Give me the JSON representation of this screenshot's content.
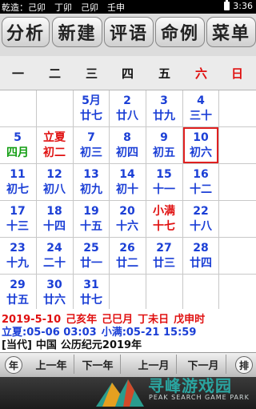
{
  "status_bar": {
    "left_text": "乾造：己卯　丁卯　己卯　壬申",
    "time": "3:36"
  },
  "tabs": [
    "分析",
    "新建",
    "评语",
    "命例",
    "菜单"
  ],
  "weekdays": [
    {
      "label": "一",
      "color": "normal"
    },
    {
      "label": "二",
      "color": "normal"
    },
    {
      "label": "三",
      "color": "normal"
    },
    {
      "label": "四",
      "color": "normal"
    },
    {
      "label": "五",
      "color": "normal"
    },
    {
      "label": "六",
      "color": "red"
    },
    {
      "label": "日",
      "color": "red"
    }
  ],
  "calendar": [
    [
      null,
      null,
      {
        "d": "5月",
        "l": "廿七"
      },
      {
        "d": "2",
        "l": "廿八"
      },
      {
        "d": "3",
        "l": "廿九"
      },
      {
        "d": "4",
        "l": "三十"
      },
      null
    ],
    [
      {
        "d": "5",
        "l": "四月",
        "l_color": "green"
      },
      {
        "d": "立夏",
        "d_color": "red",
        "l": "初二",
        "l_color": "red"
      },
      {
        "d": "7",
        "l": "初三"
      },
      {
        "d": "8",
        "l": "初四"
      },
      {
        "d": "9",
        "l": "初五"
      },
      {
        "d": "10",
        "l": "初六",
        "today": true
      },
      null
    ],
    [
      {
        "d": "11",
        "l": "初七"
      },
      {
        "d": "12",
        "l": "初八"
      },
      {
        "d": "13",
        "l": "初九"
      },
      {
        "d": "14",
        "l": "初十"
      },
      {
        "d": "15",
        "l": "十一"
      },
      {
        "d": "16",
        "l": "十二"
      },
      null
    ],
    [
      {
        "d": "17",
        "l": "十三"
      },
      {
        "d": "18",
        "l": "十四"
      },
      {
        "d": "19",
        "l": "十五"
      },
      {
        "d": "20",
        "l": "十六"
      },
      {
        "d": "小满",
        "d_color": "red",
        "l": "十七",
        "l_color": "red"
      },
      {
        "d": "22",
        "l": "十八"
      },
      null
    ],
    [
      {
        "d": "23",
        "l": "十九"
      },
      {
        "d": "24",
        "l": "二十"
      },
      {
        "d": "25",
        "l": "廿一"
      },
      {
        "d": "26",
        "l": "廿二"
      },
      {
        "d": "27",
        "l": "廿三"
      },
      {
        "d": "28",
        "l": "廿四"
      },
      null
    ],
    [
      {
        "d": "29",
        "l": "廿五"
      },
      {
        "d": "30",
        "l": "廿六"
      },
      {
        "d": "31",
        "l": "廿七"
      },
      null,
      null,
      null,
      null
    ]
  ],
  "info": {
    "line1": [
      "2019-5-10",
      "己亥年",
      "己巳月",
      "丁未日",
      "戊申时"
    ],
    "line2": [
      "立夏:05-06 03:03",
      "小满:05-21 15:59"
    ],
    "line3": [
      "[当代]",
      "中国",
      "公历纪元2019年"
    ]
  },
  "nav": {
    "year_btn": "年",
    "prev_year": "上一年",
    "next_year": "下一年",
    "prev_month": "上一月",
    "next_month": "下一月",
    "sort_btn": "排"
  },
  "watermark": {
    "title": "寻峰游戏园",
    "subtitle": "PEAK SEARCH GAME PARK"
  },
  "colors": {
    "accent_blue": "#1b3fd6",
    "red": "#e01010",
    "green": "#119d11"
  }
}
